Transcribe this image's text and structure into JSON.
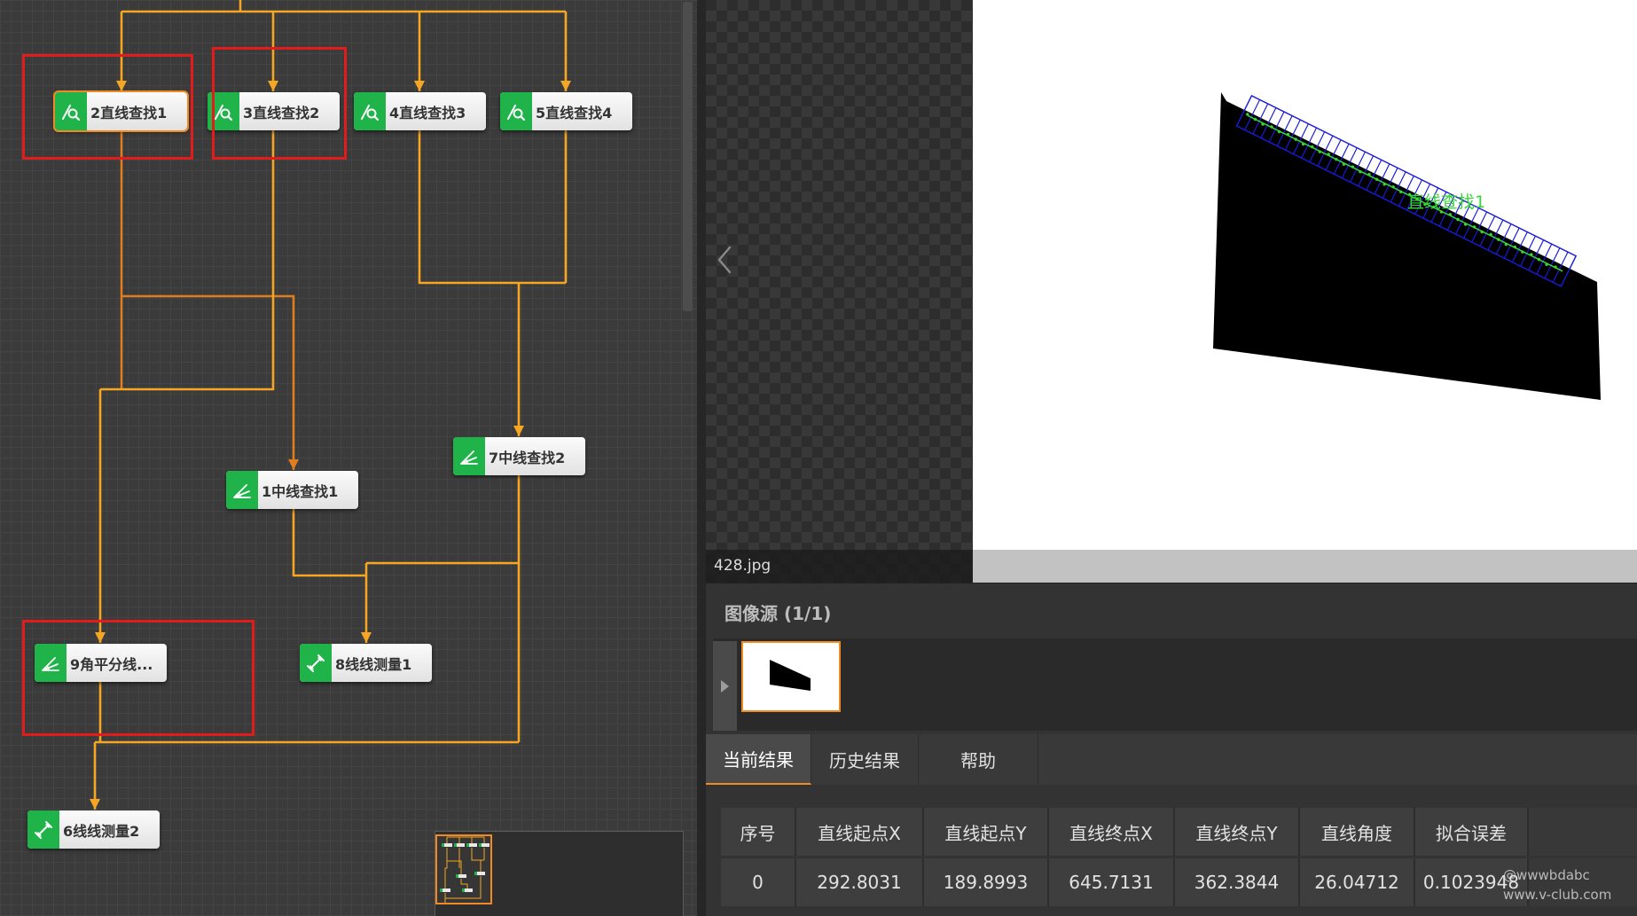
{
  "colors": {
    "accent": "#f08a24",
    "node_green": "#1fb34a",
    "highlight": "#e21b1b",
    "line": "#f5a623",
    "line_dark": "#e07d1e",
    "caliper": "#1a1adb",
    "edge": "#37d43a"
  },
  "flow": {
    "nodes": [
      {
        "label": "2直线查找1",
        "icon": "line-find-icon",
        "selected": true
      },
      {
        "label": "3直线查找2",
        "icon": "line-find-icon"
      },
      {
        "label": "4直线查找3",
        "icon": "line-find-icon"
      },
      {
        "label": "5直线查找4",
        "icon": "line-find-icon"
      },
      {
        "label": "7中线查找2",
        "icon": "angle-icon"
      },
      {
        "label": "1中线查找1",
        "icon": "angle-icon"
      },
      {
        "label": "9角平分线...",
        "icon": "angle-icon"
      },
      {
        "label": "8线线测量1",
        "icon": "measure-icon"
      },
      {
        "label": "6线线测量2",
        "icon": "measure-icon"
      }
    ]
  },
  "viewer": {
    "filename": "428.jpg",
    "overlay_label": "直线查找1",
    "nav_icon": "chevron-left-icon"
  },
  "image_source": {
    "title": "图像源 (1/1)"
  },
  "tabs": [
    {
      "label": "当前结果",
      "active": true
    },
    {
      "label": "历史结果"
    },
    {
      "label": "帮助"
    }
  ],
  "results_table": {
    "headers": [
      "序号",
      "直线起点X",
      "直线起点Y",
      "直线终点X",
      "直线终点Y",
      "直线角度",
      "拟合误差"
    ],
    "rows": [
      [
        "0",
        "292.8031",
        "189.8993",
        "645.7131",
        "362.3844",
        "26.04712",
        "0.1023948"
      ]
    ]
  },
  "watermark": {
    "line1": "@wwwbdabc",
    "line2": "www.v-club.com"
  }
}
